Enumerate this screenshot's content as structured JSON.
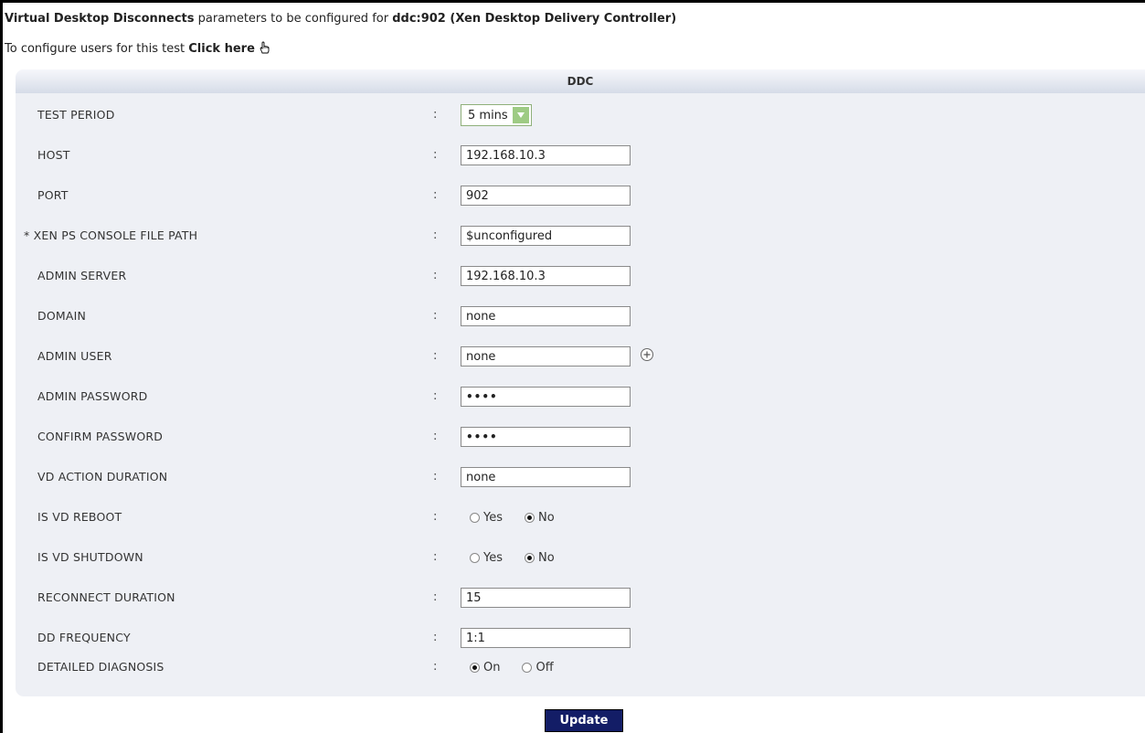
{
  "header": {
    "test_name": "Virtual Desktop Disconnects",
    "middle_text": " parameters to be configured for ",
    "target": "ddc:902 (Xen Desktop Delivery Controller)"
  },
  "users_link": {
    "prefix": "To configure users for this test ",
    "link": "Click here"
  },
  "panel": {
    "title": "DDC"
  },
  "fields": {
    "test_period": {
      "label": "TEST PERIOD",
      "value": "5 mins"
    },
    "host": {
      "label": "HOST",
      "value": "192.168.10.3"
    },
    "port": {
      "label": "PORT",
      "value": "902"
    },
    "xen_ps_path": {
      "label": "* XEN PS CONSOLE FILE PATH",
      "value": "$unconfigured"
    },
    "admin_server": {
      "label": "ADMIN SERVER",
      "value": "192.168.10.3"
    },
    "domain": {
      "label": "DOMAIN",
      "value": "none"
    },
    "admin_user": {
      "label": "ADMIN USER",
      "value": "none"
    },
    "admin_password": {
      "label": "ADMIN PASSWORD",
      "value": "••••"
    },
    "confirm_password": {
      "label": "CONFIRM PASSWORD",
      "value": "••••"
    },
    "vd_action_duration": {
      "label": "VD ACTION DURATION",
      "value": "none"
    },
    "is_vd_reboot": {
      "label": "IS VD REBOOT",
      "options": [
        "Yes",
        "No"
      ],
      "selected": "No"
    },
    "is_vd_shutdown": {
      "label": "IS VD SHUTDOWN",
      "options": [
        "Yes",
        "No"
      ],
      "selected": "No"
    },
    "reconnect_duration": {
      "label": "RECONNECT DURATION",
      "value": "15"
    },
    "dd_frequency": {
      "label": "DD FREQUENCY",
      "value": "1:1"
    },
    "detailed_diagnosis": {
      "label": "DETAILED DIAGNOSIS",
      "options": [
        "On",
        "Off"
      ],
      "selected": "On"
    }
  },
  "colon": ":",
  "update_label": "Update"
}
